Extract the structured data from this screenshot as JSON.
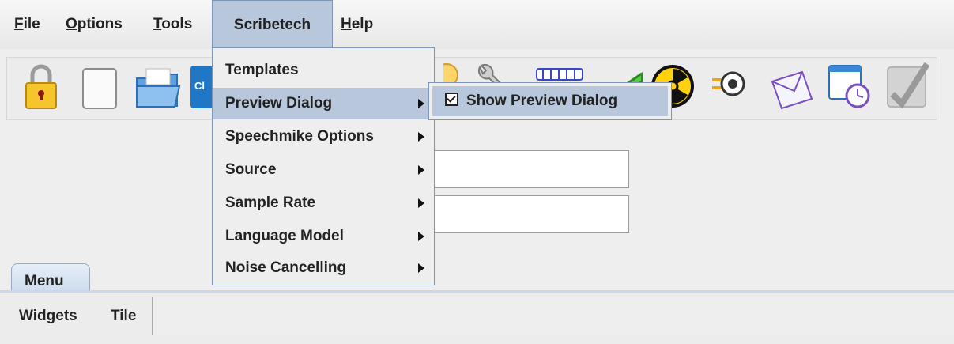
{
  "menubar": {
    "items": [
      {
        "label": "File",
        "mnemonic": "F",
        "rest": "ile"
      },
      {
        "label": "Options",
        "mnemonic": "O",
        "rest": "ptions"
      },
      {
        "label": "Tools",
        "mnemonic": "T",
        "rest": "ools"
      },
      {
        "label": "Scribetech"
      },
      {
        "label": "Help",
        "mnemonic": "H",
        "rest": "elp"
      }
    ]
  },
  "toolbar": {
    "icons": [
      "lock-icon",
      "blank-document-icon",
      "folder-icon",
      "partial-c-button-icon",
      "cloud-icon",
      "wrench-icon",
      "tape-icon",
      "antenna-icon",
      "radioactive-icon",
      "plug-icon",
      "envelope-icon",
      "clock-window-icon",
      "disabled-check-icon"
    ],
    "partial_button_text": "Cl"
  },
  "dropdown": {
    "items": [
      {
        "label": "Templates",
        "submenu": false
      },
      {
        "label": "Preview Dialog",
        "submenu": true
      },
      {
        "label": "Speechmike Options",
        "submenu": true
      },
      {
        "label": "Source",
        "submenu": true
      },
      {
        "label": "Sample Rate",
        "submenu": true
      },
      {
        "label": "Language Model",
        "submenu": true
      },
      {
        "label": "Noise Cancelling",
        "submenu": true
      }
    ]
  },
  "submenu": {
    "label": "Show Preview Dialog",
    "checked": true
  },
  "tabs": {
    "menu_label": "Menu"
  },
  "bottom": {
    "widgets_label": "Widgets",
    "tile_label": "Tile"
  },
  "colors": {
    "menu_highlight": "#b8c7dc",
    "border_accent": "#7f95b8",
    "background": "#eeeeee"
  }
}
